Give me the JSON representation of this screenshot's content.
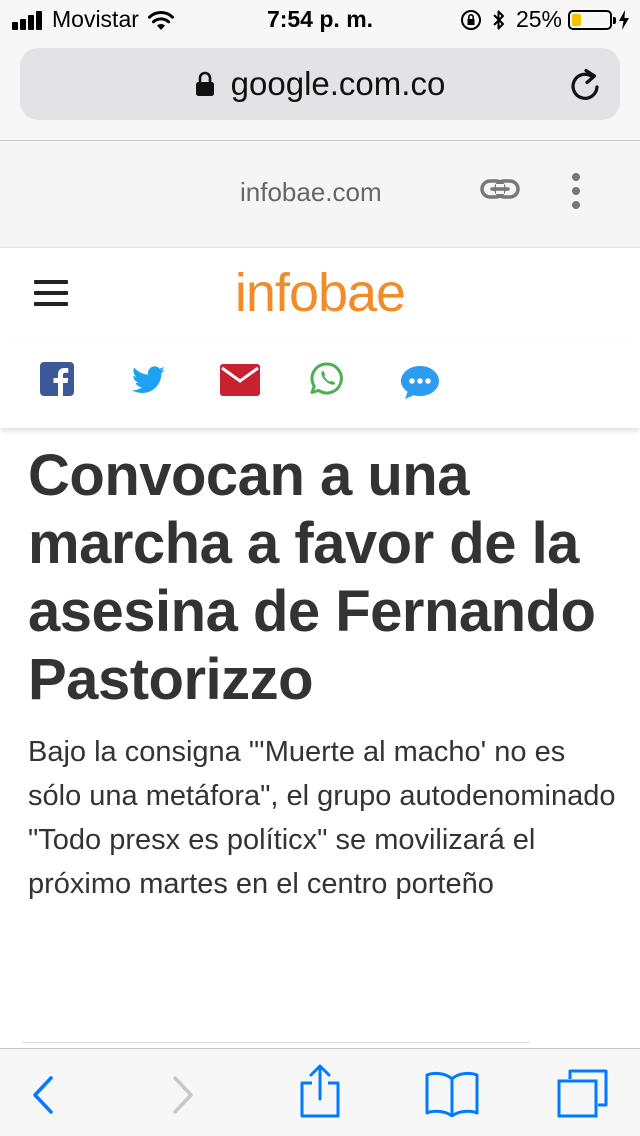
{
  "status_bar": {
    "carrier": "Movistar",
    "time": "7:54 p. m.",
    "battery_percent_label": "25%",
    "battery_level": 0.25,
    "battery_color": "#f5c400"
  },
  "browser": {
    "url": "google.com.co",
    "icons": [
      "lock-icon",
      "reload-icon"
    ]
  },
  "amp_header": {
    "domain": "infobae.com",
    "icons": [
      "link-icon",
      "more-icon"
    ]
  },
  "site": {
    "logo_text": "infobae",
    "logo_color": "#f28c28",
    "menu_icon": "hamburger-menu-icon"
  },
  "share": {
    "buttons": [
      {
        "name": "facebook-share-button",
        "icon": "facebook-icon",
        "color": "#3b5998"
      },
      {
        "name": "twitter-share-button",
        "icon": "twitter-icon",
        "color": "#1da1f2"
      },
      {
        "name": "email-share-button",
        "icon": "mail-icon",
        "color": "#c8202f"
      },
      {
        "name": "whatsapp-share-button",
        "icon": "whatsapp-icon",
        "color": "#4caf50"
      },
      {
        "name": "sms-share-button",
        "icon": "chat-bubble-icon",
        "color": "#2d9bf0"
      }
    ]
  },
  "article": {
    "headline": "Convocan a una marcha a favor de la asesina de Fernando Pastorizzo",
    "summary": "Bajo la consigna \"'Muerte al macho' no es sólo una metáfora\", el grupo autodenominado \"Todo presx es políticx\" se movilizará el próximo martes en el centro porteño"
  },
  "toolbar": {
    "accent_color": "#007aff",
    "disabled_color": "#c7c7cc",
    "buttons": [
      "back-icon",
      "forward-icon",
      "share-icon",
      "bookmarks-icon",
      "tabs-icon"
    ]
  }
}
